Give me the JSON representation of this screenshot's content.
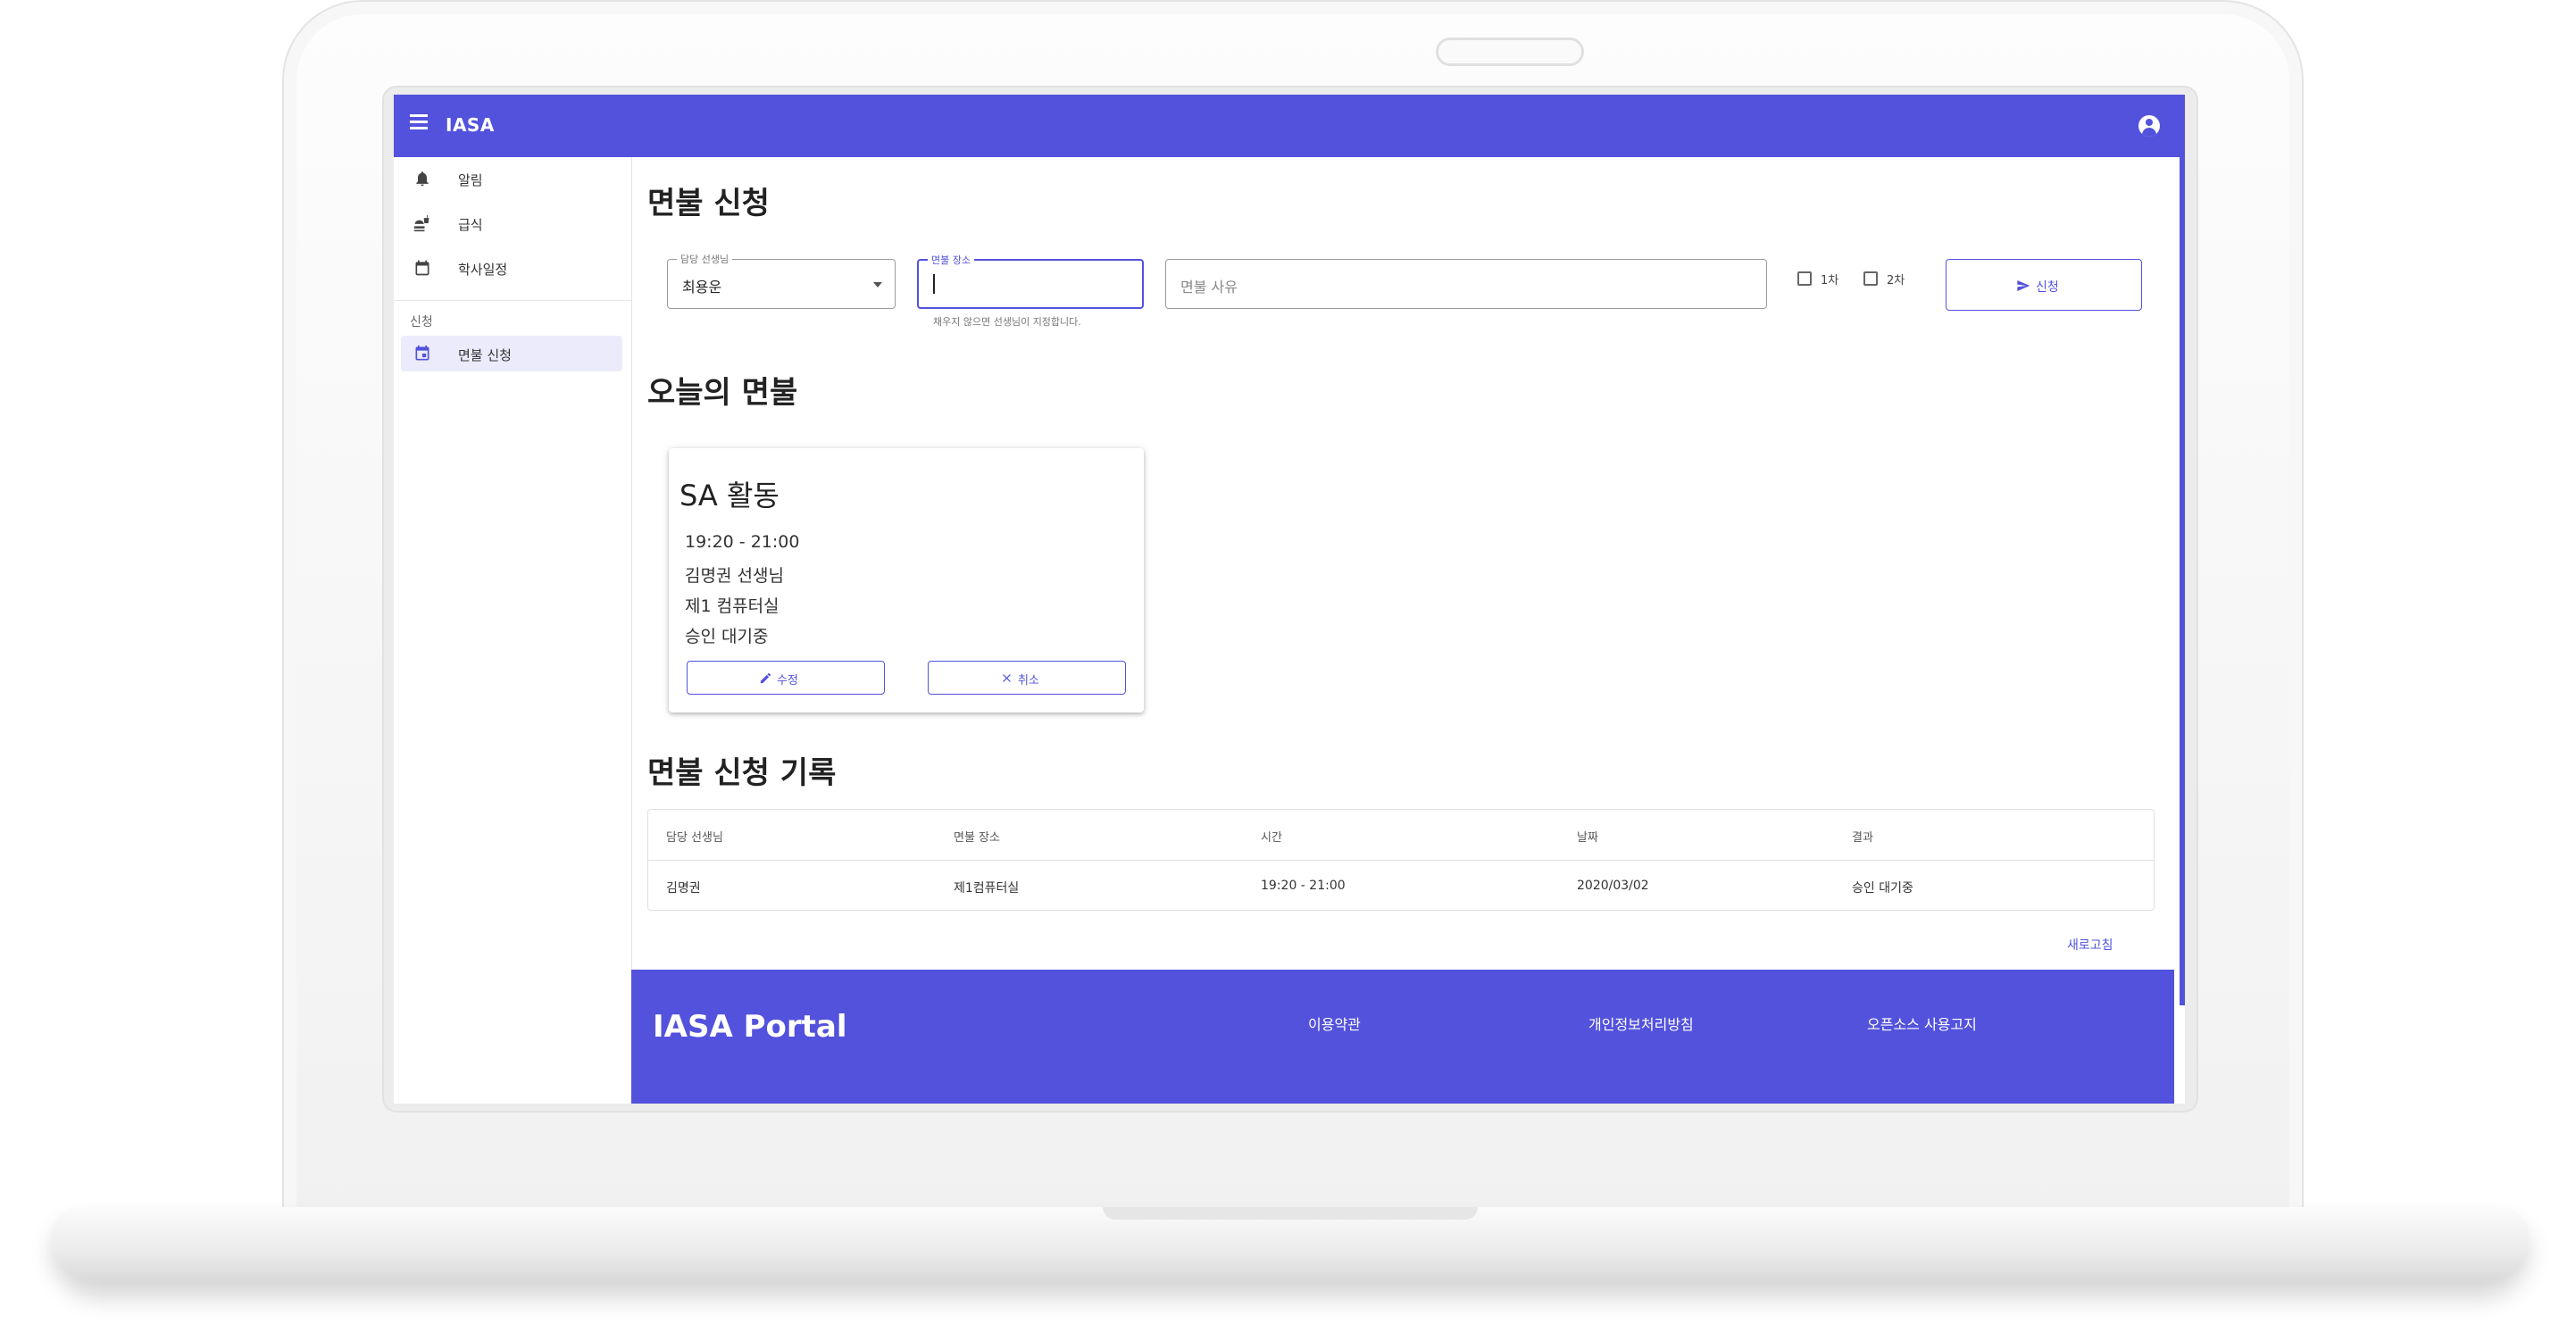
{
  "app": {
    "title": "IASA"
  },
  "sidebar": {
    "items": [
      {
        "label": "알림",
        "icon": "bell-icon"
      },
      {
        "label": "급식",
        "icon": "fastfood-icon"
      },
      {
        "label": "학사일정",
        "icon": "calendar-icon"
      }
    ],
    "section_label": "신청",
    "section_items": [
      {
        "label": "면불 신청",
        "icon": "event-icon",
        "active": true
      }
    ]
  },
  "form": {
    "heading": "면불 신청",
    "teacher_label": "담당 선생님",
    "teacher_value": "최용운",
    "place_label": "면불 장소",
    "place_value": "",
    "place_hint": "채우지 않으면 선생님이 지정합니다.",
    "reason_placeholder": "면불 사유",
    "check1_label": "1차",
    "check1_checked": false,
    "check2_label": "2차",
    "check2_checked": false,
    "submit_label": "신청"
  },
  "today": {
    "heading": "오늘의 면불",
    "card": {
      "title": "SA 활동",
      "time": "19:20 - 21:00",
      "teacher": "김명권 선생님",
      "place": "제1 컴퓨터실",
      "status": "승인 대기중",
      "edit_label": "수정",
      "cancel_label": "취소"
    }
  },
  "history": {
    "heading": "면불 신청 기록",
    "columns": [
      "담당 선생님",
      "면불 장소",
      "시간",
      "날짜",
      "결과"
    ],
    "rows": [
      [
        "김명권",
        "제1컴퓨터실",
        "19:20 - 21:00",
        "2020/03/02",
        "승인 대기중"
      ]
    ],
    "refresh_label": "새로고침"
  },
  "footer": {
    "brand": "IASA Portal",
    "links": [
      "이용약관",
      "개인정보처리방침",
      "오픈소스 사용고지"
    ]
  },
  "colors": {
    "primary": "#5352dc",
    "active_bg": "#ebebfc"
  }
}
